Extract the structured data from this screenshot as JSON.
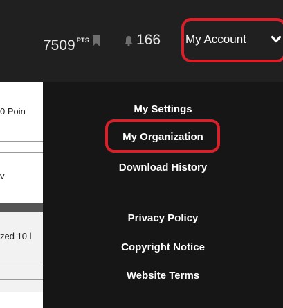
{
  "header": {
    "points_value": "7509",
    "points_unit": "PTS",
    "notification_count": "166",
    "account_label": "My Account"
  },
  "left_pane": {
    "line1": "0 Poin",
    "line2": "v",
    "line3": "zed 10 l"
  },
  "menu": {
    "group1": [
      "My Settings",
      "My Organization",
      "Download History"
    ],
    "group2": [
      "Privacy Policy",
      "Copyright Notice",
      "Website Terms"
    ]
  },
  "colors": {
    "header_bg": "#202020",
    "menu_bg": "#161616",
    "highlight": "#d8202a",
    "icon_gray": "#6e6e6e"
  },
  "icons": {
    "bookmark": "bookmark-icon",
    "bell": "bell-icon",
    "chevron": "chevron-down-icon"
  }
}
